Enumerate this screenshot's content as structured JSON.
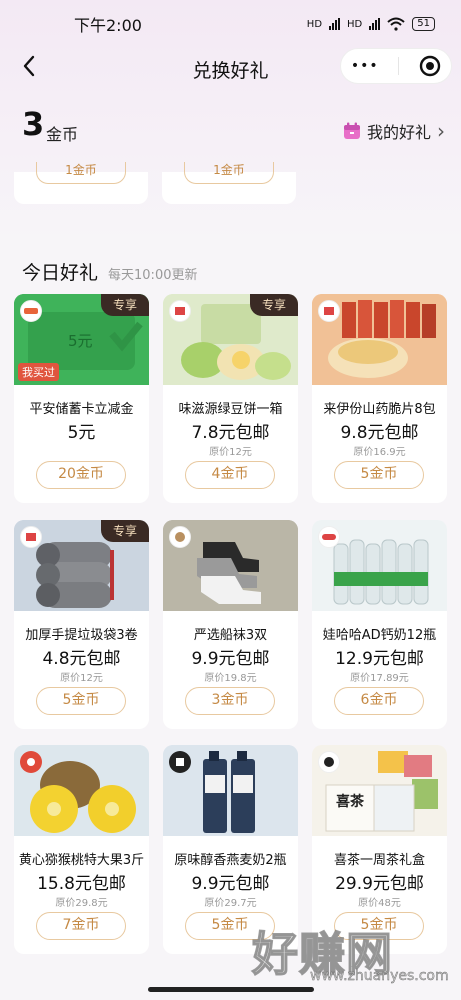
{
  "status_bar": {
    "time": "下午2:00",
    "network_1": "HD",
    "network_2": "HD",
    "battery": "51"
  },
  "nav": {
    "title": "兑换好礼",
    "more_glyph": "•••",
    "back_icon": "chevron-left-icon",
    "record_icon": "target-icon"
  },
  "coins": {
    "amount": "3",
    "unit": "金币",
    "my_gift_label": "我的好礼",
    "arrow": "›"
  },
  "partial_row": [
    {
      "label": "1金币"
    },
    {
      "label": "1金币"
    }
  ],
  "section": {
    "title": "今日好礼",
    "subtitle": "每天10:00更新"
  },
  "products": [
    {
      "name": "平安储蓄卡立减金",
      "price": "5元",
      "original": "",
      "button": "20金币",
      "badge": "专享",
      "bought": "我买过",
      "voucher_text": "5元",
      "image": "green-voucher"
    },
    {
      "name": "味滋源绿豆饼一箱",
      "price": "7.8元包邮",
      "original": "原价12元",
      "button": "4金币",
      "badge": "专享",
      "image": "mung-bean-cakes"
    },
    {
      "name": "来伊份山药脆片8包",
      "price": "9.8元包邮",
      "original": "原价16.9元",
      "button": "5金币",
      "image": "yam-chips"
    },
    {
      "name": "加厚手提垃圾袋3卷",
      "price": "4.8元包邮",
      "original": "原价12元",
      "button": "5金币",
      "badge": "专享",
      "image": "trash-bag-rolls"
    },
    {
      "name": "严选船袜3双",
      "price": "9.9元包邮",
      "original": "原价19.8元",
      "button": "3金币",
      "image": "boat-socks"
    },
    {
      "name": "娃哈哈AD钙奶12瓶",
      "price": "12.9元包邮",
      "original": "原价17.89元",
      "button": "6金币",
      "image": "ad-calcium-milk"
    },
    {
      "name": "黄心猕猴桃特大果3斤",
      "price": "15.8元包邮",
      "original": "原价29.8元",
      "button": "7金币",
      "image": "golden-kiwi"
    },
    {
      "name": "原味醇香燕麦奶2瓶",
      "price": "9.9元包邮",
      "original": "原价29.7元",
      "button": "5金币",
      "image": "oat-milk"
    },
    {
      "name": "喜茶一周茶礼盒",
      "price": "29.9元包邮",
      "original": "原价48元",
      "button": "5金币",
      "box_text": "喜茶",
      "image": "heytea-box"
    }
  ],
  "watermark": {
    "text": "好赚网",
    "url": "www.zhuanyes.com"
  },
  "colors": {
    "accent": "#c58a45",
    "accent_border": "#e8c9a0",
    "badge_bg": "#3a2a24"
  }
}
